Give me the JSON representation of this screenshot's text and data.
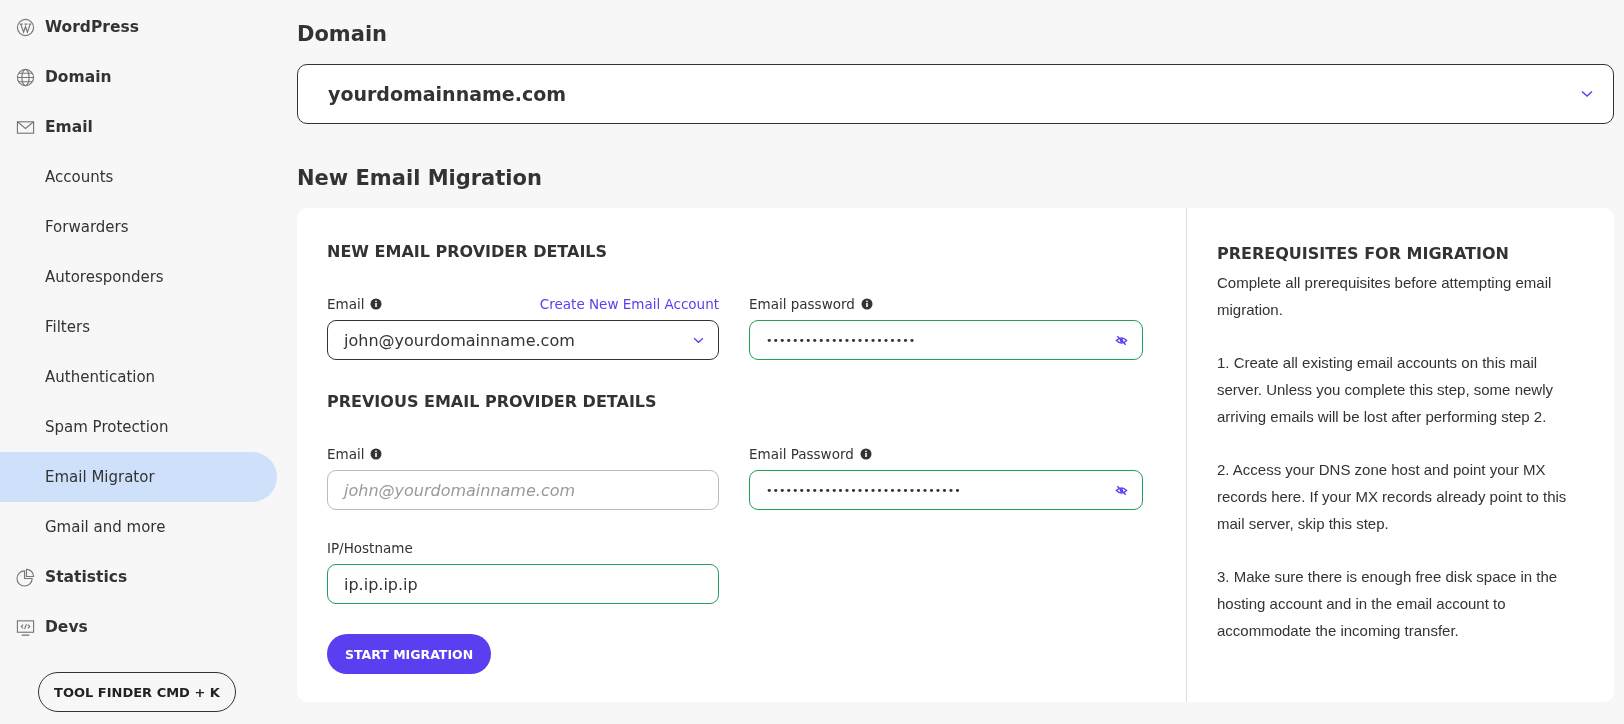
{
  "sidebar": {
    "items": [
      {
        "label": "WordPress",
        "kind": "section",
        "selected": false
      },
      {
        "label": "Domain",
        "kind": "section",
        "selected": false
      },
      {
        "label": "Email",
        "kind": "section",
        "selected": false
      },
      {
        "label": "Accounts",
        "kind": "sub",
        "selected": false
      },
      {
        "label": "Forwarders",
        "kind": "sub",
        "selected": false
      },
      {
        "label": "Autoresponders",
        "kind": "sub",
        "selected": false
      },
      {
        "label": "Filters",
        "kind": "sub",
        "selected": false
      },
      {
        "label": "Authentication",
        "kind": "sub",
        "selected": false
      },
      {
        "label": "Spam Protection",
        "kind": "sub",
        "selected": false
      },
      {
        "label": "Email Migrator",
        "kind": "sub",
        "selected": true
      },
      {
        "label": "Gmail and more",
        "kind": "sub",
        "selected": false
      },
      {
        "label": "Statistics",
        "kind": "section",
        "selected": false
      },
      {
        "label": "Devs",
        "kind": "section",
        "selected": false
      }
    ],
    "tool_finder": "TOOL FINDER CMD + K"
  },
  "domain": {
    "title": "Domain",
    "value": "yourdomainname.com"
  },
  "migration": {
    "title": "New Email Migration",
    "sections": [
      {
        "heading": "NEW EMAIL PROVIDER DETAILS",
        "link": "Create New Email Account",
        "fields": [
          {
            "label": "Email",
            "info": true,
            "kind": "select",
            "value": "john@yourdomainname.com",
            "valid": false
          },
          {
            "label": "Email password",
            "info": true,
            "kind": "password",
            "value": "•••••••••••••••••••••••",
            "valid": true
          }
        ]
      },
      {
        "heading": "PREVIOUS EMAIL PROVIDER DETAILS",
        "fields": [
          {
            "label": "Email",
            "info": true,
            "kind": "text",
            "placeholder": "john@yourdomainname.com",
            "valid": false
          },
          {
            "label": "Email Password",
            "info": true,
            "kind": "password",
            "value": "••••••••••••••••••••••••••••••",
            "valid": true
          },
          {
            "label": "IP/Hostname",
            "info": false,
            "kind": "text",
            "value": "ip.ip.ip.ip",
            "valid": true
          }
        ]
      }
    ],
    "button": "START MIGRATION",
    "prerequisites": {
      "heading": "PREREQUISITES FOR MIGRATION",
      "paragraphs": [
        "Complete all prerequisites before attempting email migration.",
        "1. Create all existing email accounts on this mail server. Unless you complete this step, some newly arriving emails will be lost after performing step 2.",
        "2. Access your DNS zone host and point your MX records here. If your MX records already point to this mail server, skip this step.",
        "3. Make sure there is enough free disk space in the hosting account and in the email account to accommodate the incoming transfer."
      ]
    }
  }
}
